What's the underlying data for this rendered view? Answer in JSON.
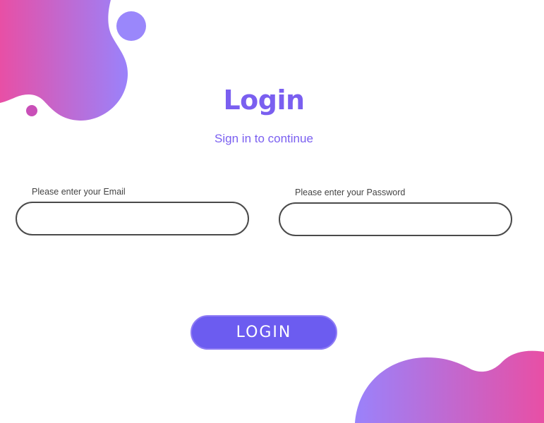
{
  "header": {
    "title": "Login",
    "subtitle": "Sign in to continue"
  },
  "form": {
    "email": {
      "label": "Please enter your Email",
      "value": "",
      "placeholder": ""
    },
    "password": {
      "label": "Please enter your Password",
      "value": "",
      "placeholder": ""
    },
    "submit_label": "LOGIN"
  },
  "colors": {
    "accent": "#6c5cf0",
    "title": "#7a5ff0",
    "gradient_pink": "#e84fa5",
    "gradient_purple": "#9a82fb"
  }
}
